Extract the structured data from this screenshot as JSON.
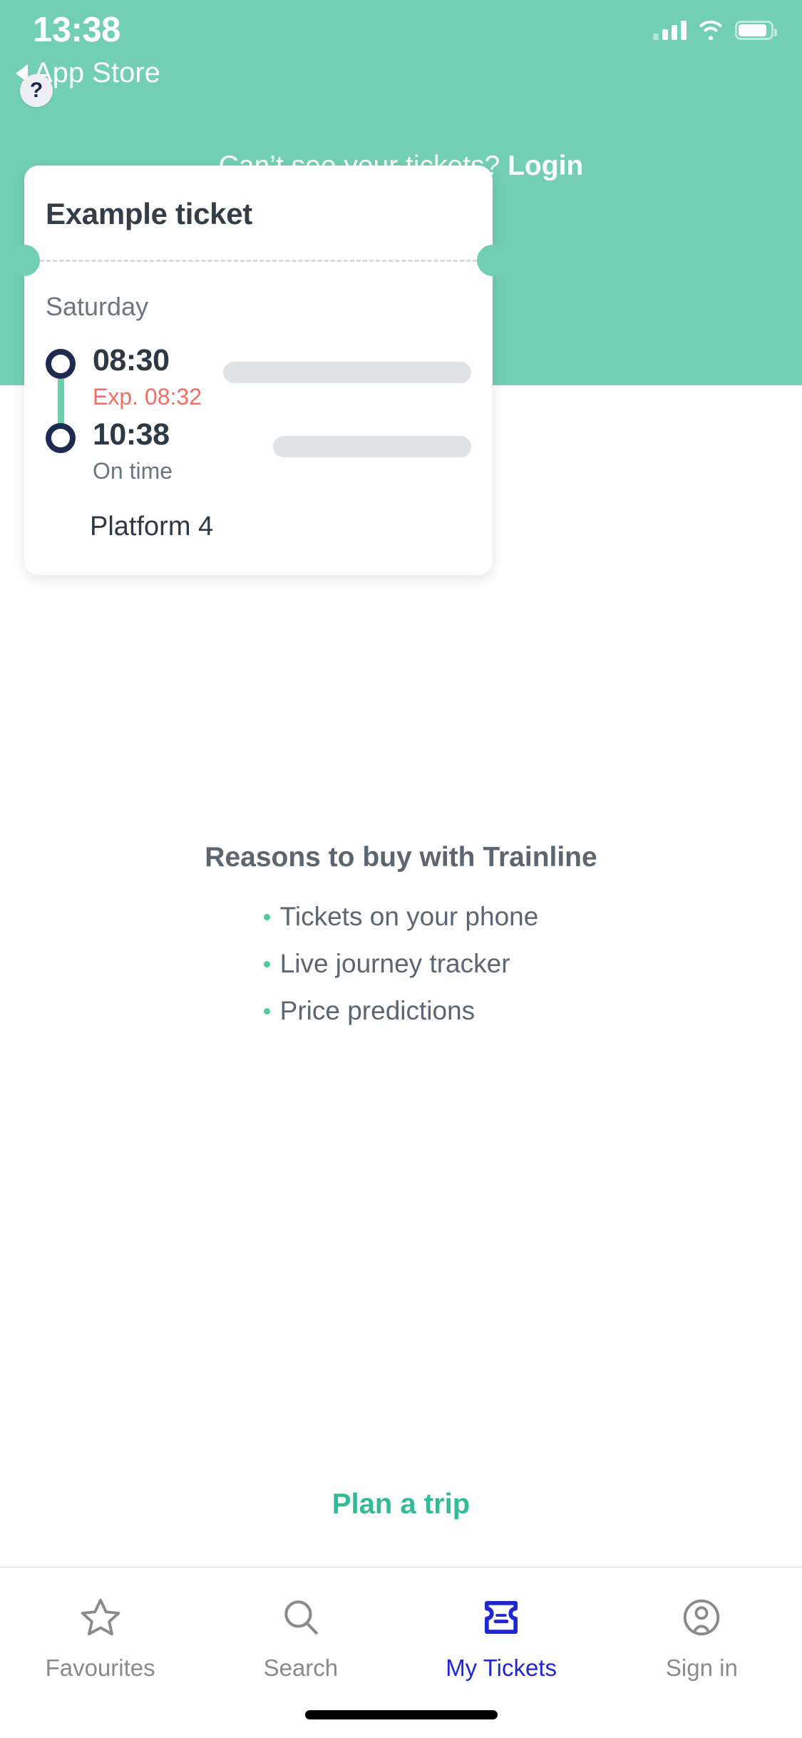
{
  "status_bar": {
    "time": "13:38",
    "back_label": "App Store",
    "icons": [
      "signal-icon",
      "wifi-icon",
      "battery-icon"
    ]
  },
  "header": {
    "help_label": "?",
    "login_prompt": "Can’t see your tickets?",
    "login_link": "Login",
    "background_color": "#72CFB4"
  },
  "ticket": {
    "title": "Example ticket",
    "day": "Saturday",
    "legs": [
      {
        "time": "08:30",
        "status": "Exp. 08:32",
        "status_type": "late"
      },
      {
        "time": "10:38",
        "status": "On time",
        "status_type": "ontime"
      }
    ],
    "platform": "Platform 4"
  },
  "reasons": {
    "heading": "Reasons to buy with Trainline",
    "items": [
      "Tickets on your phone",
      "Live journey tracker",
      "Price predictions"
    ],
    "bullet_color": "#4CC9A0"
  },
  "plan_trip": {
    "label": "Plan a trip",
    "color": "#33BB97"
  },
  "tabbar": {
    "items": [
      {
        "label": "Favourites",
        "icon": "star-icon",
        "active": false
      },
      {
        "label": "Search",
        "icon": "search-icon",
        "active": false
      },
      {
        "label": "My Tickets",
        "icon": "ticket-icon",
        "active": true
      },
      {
        "label": "Sign in",
        "icon": "person-circle-icon",
        "active": false
      }
    ],
    "active_color": "#2027CF",
    "inactive_color": "#8A8A8E"
  }
}
